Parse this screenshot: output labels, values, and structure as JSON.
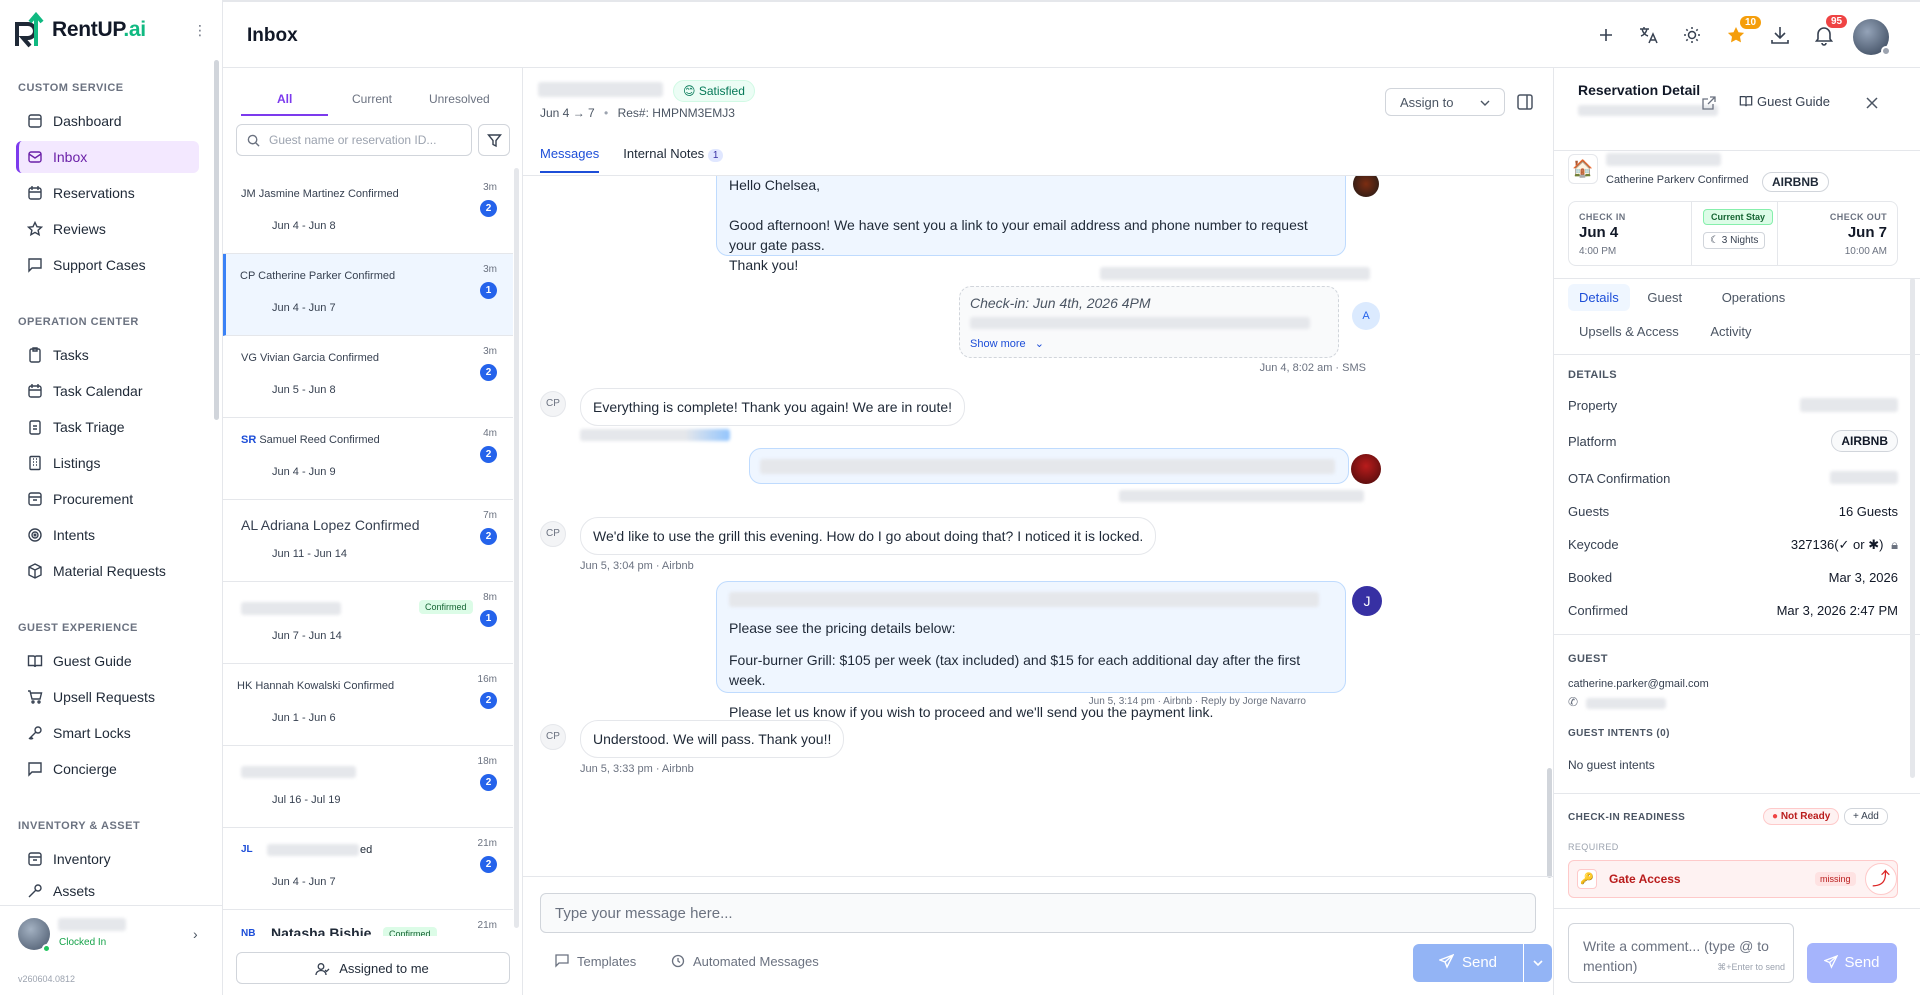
{
  "app": {
    "name": "RentUP",
    "name_suffix": ".ai",
    "version": "v260604.0812"
  },
  "sidebar": {
    "sections": [
      {
        "title": "CUSTOM SERVICE",
        "items": [
          {
            "label": "Dashboard",
            "icon": "dashboard-icon"
          },
          {
            "label": "Inbox",
            "icon": "inbox-icon",
            "active": true
          },
          {
            "label": "Reservations",
            "icon": "calendar-icon"
          },
          {
            "label": "Reviews",
            "icon": "star-icon"
          },
          {
            "label": "Support Cases",
            "icon": "message-square-icon"
          }
        ]
      },
      {
        "title": "OPERATION CENTER",
        "items": [
          {
            "label": "Tasks",
            "icon": "clipboard-icon"
          },
          {
            "label": "Task Calendar",
            "icon": "calendar-icon"
          },
          {
            "label": "Task Triage",
            "icon": "clipboard-icon"
          },
          {
            "label": "Listings",
            "icon": "building-icon"
          },
          {
            "label": "Procurement",
            "icon": "archive-icon"
          },
          {
            "label": "Intents",
            "icon": "target-icon"
          },
          {
            "label": "Material Requests",
            "icon": "package-icon"
          }
        ]
      },
      {
        "title": "GUEST EXPERIENCE",
        "items": [
          {
            "label": "Guest Guide",
            "icon": "book-icon"
          },
          {
            "label": "Upsell Requests",
            "icon": "cart-icon"
          },
          {
            "label": "Smart Locks",
            "icon": "key-icon"
          },
          {
            "label": "Concierge",
            "icon": "message-square-icon"
          }
        ]
      },
      {
        "title": "INVENTORY & ASSET",
        "items": [
          {
            "label": "Inventory",
            "icon": "archive-icon"
          },
          {
            "label": "Assets",
            "icon": "key-icon"
          }
        ]
      }
    ],
    "user": {
      "status": "Clocked In"
    }
  },
  "header": {
    "title": "Inbox",
    "badges": {
      "favorites": "10",
      "notifications": "95"
    }
  },
  "convlist": {
    "tabs": [
      "All",
      "Current",
      "Unresolved"
    ],
    "search_placeholder": "Guest name or reservation ID...",
    "items": [
      {
        "initials": "JM",
        "name": "Jasmine Martinez Confirmed",
        "dates": "Jun 4 - Jun 8",
        "time": "3m",
        "count": "2"
      },
      {
        "initials": "CP",
        "name": "Catherine Parker Confirmed",
        "dates": "Jun 4 - Jun 7",
        "time": "3m",
        "count": "1",
        "selected": true
      },
      {
        "initials": "VG",
        "name": "Vivian Garcia Confirmed",
        "dates": "Jun 5 - Jun 8",
        "time": "3m",
        "count": "2"
      },
      {
        "initials": "SR",
        "name": "Samuel Reed Confirmed",
        "dates": "Jun 4 - Jun 9",
        "time": "4m",
        "count": "2"
      },
      {
        "initials": "AL",
        "name": "Adriana Lopez Confirmed",
        "dates": "Jun 11 - Jun 14",
        "time": "7m",
        "count": "2"
      },
      {
        "initials": "",
        "name": "Confirmed",
        "dates": "Jun 7 - Jun 14",
        "time": "8m",
        "count": "1"
      },
      {
        "initials": "HK",
        "name": "Hannah Kowalski Confirmed",
        "dates": "Jun 1 - Jun 6",
        "time": "16m",
        "count": "2"
      },
      {
        "initials": "",
        "name": "",
        "dates": "Jul 16 - Jul 19",
        "time": "18m",
        "count": "2"
      },
      {
        "initials": "JL",
        "name": "ed",
        "dates": "Jun 4 - Jun 7",
        "time": "21m",
        "count": "2"
      },
      {
        "initials": "NB",
        "name": "Natasha Bishie",
        "badge": "Confirmed",
        "time": "21m"
      }
    ],
    "assigned_button": "Assigned to me"
  },
  "chat": {
    "sentiment": "😊 Satisfied",
    "dates": "Jun 4 → 7",
    "reservation": "Res#: HMPNM3EMJ3",
    "assign_label": "Assign to",
    "tabs": {
      "messages": "Messages",
      "notes": "Internal Notes",
      "notes_count": "1"
    },
    "messages": {
      "m1_line1": "Hello Chelsea,",
      "m1_line2": "Good afternoon! We have sent you a link to your email address and phone number to request your gate pass.",
      "m1_line3": "Thank you!",
      "checkin": "Check-in: Jun 4th, 2026  4PM",
      "show_more": "Show more",
      "checkin_meta": "Jun 4, 8:02 am · SMS",
      "m2": "Everything is complete! Thank you again! We are in route!",
      "m3": "We'd like to use the grill this evening. How do I go about doing that? I noticed it is locked.",
      "m3_meta": "Jun 5, 3:04 pm · Airbnb",
      "m4_line1": "Please see the pricing details below:",
      "m4_line2": "Four-burner Grill: $105 per week (tax included) and $15 for each additional day after the first week.",
      "m4_line3": "Please let us know if you wish to proceed and we'll send you the payment link.",
      "m4_meta": "Jun 5, 3:14 pm · Airbnb · Reply by Jorge Navarro",
      "m5": "Understood. We will pass. Thank you!!",
      "m5_meta": "Jun 5, 3:33 pm · Airbnb",
      "avatar_cp": "CP",
      "avatar_a": "A",
      "avatar_j": "J"
    },
    "composer_placeholder": "Type your message here...",
    "templates": "Templates",
    "automated": "Automated Messages",
    "send": "Send"
  },
  "detail": {
    "title": "Reservation Detail",
    "guest_guide": "Guest Guide",
    "guest_name": "Catherine Parkerv Confirmed",
    "platform": "AIRBNB",
    "check_in_label": "CHECK IN",
    "check_in_date": "Jun 4",
    "check_in_time": "4:00 PM",
    "current_stay": "Current Stay",
    "nights": "3 Nights",
    "check_out_label": "CHECK OUT",
    "check_out_date": "Jun 7",
    "check_out_time": "10:00 AM",
    "tabs": [
      "Details",
      "Guest",
      "Operations",
      "Upsells & Access",
      "Activity"
    ],
    "details_heading": "DETAILS",
    "rows": {
      "property": "Property",
      "platform_label": "Platform",
      "ota": "OTA Confirmation",
      "guests_label": "Guests",
      "guests": "16 Guests",
      "keycode_label": "Keycode",
      "keycode": "327136(✓ or ✱)",
      "booked_label": "Booked",
      "booked": "Mar 3, 2026",
      "confirmed_label": "Confirmed",
      "confirmed": "Mar 3, 2026 2:47 PM"
    },
    "guest_heading": "GUEST",
    "email": "catherine.parker@gmail.com",
    "intents_heading": "GUEST INTENTS (0)",
    "no_intents": "No guest intents",
    "readiness_heading": "CHECK-IN READINESS",
    "not_ready": "Not Ready",
    "add": "+ Add",
    "required": "REQUIRED",
    "gate_access": "Gate Access",
    "missing": "missing",
    "comment_placeholder": "Write a comment... (type @ to mention)",
    "comment_hint": "⌘+Enter to send",
    "send": "Send"
  },
  "colors": {
    "accent": "#7c3aed",
    "blue": "#2563eb",
    "red": "#ef4444",
    "green": "#10b981"
  }
}
